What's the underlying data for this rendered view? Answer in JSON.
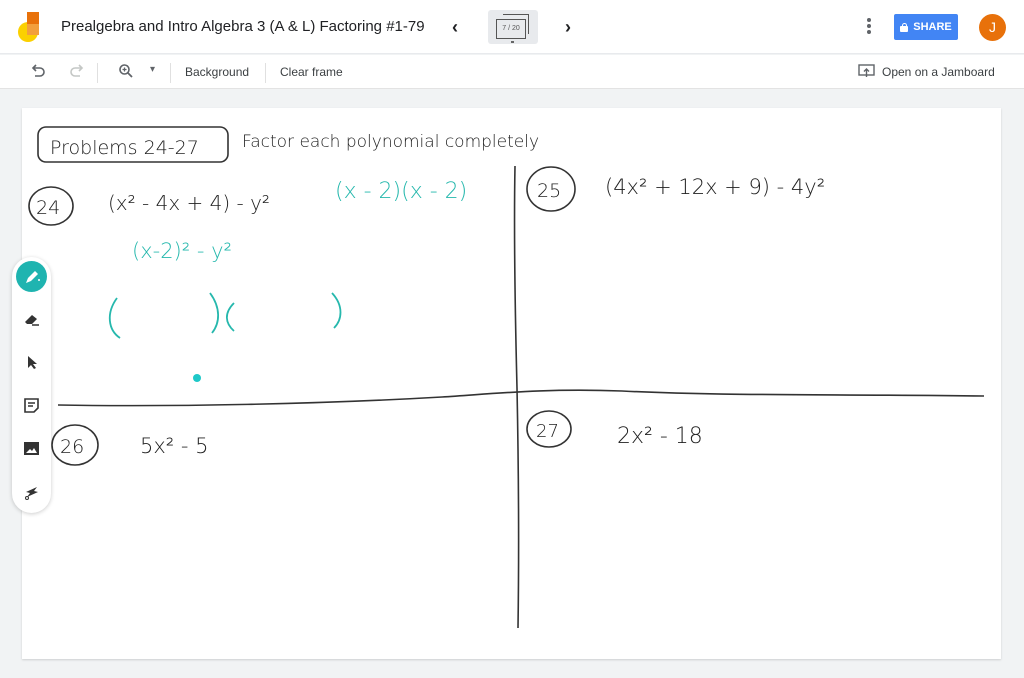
{
  "header": {
    "title": "Prealgebra and Intro Algebra 3 (A & L) Factoring #1-79",
    "prev_icon": "chevron-left-icon",
    "next_icon": "chevron-right-icon",
    "frame_indicator": "7 / 20",
    "more_icon": "more-vert-icon",
    "share_label": "SHARE",
    "avatar_initial": "J",
    "colors": {
      "share": "#4285f4",
      "avatar": "#e8710a"
    }
  },
  "toolbar": {
    "undo_icon": "undo-icon",
    "redo_icon": "redo-icon",
    "zoom_icon": "zoom-in-icon",
    "background_label": "Background",
    "clear_frame_label": "Clear frame",
    "open_jamboard_label": "Open on a Jamboard"
  },
  "tools": [
    {
      "name": "pen",
      "icon": "pen-icon",
      "active": true
    },
    {
      "name": "eraser",
      "icon": "eraser-icon",
      "active": false
    },
    {
      "name": "select",
      "icon": "select-arrow-icon",
      "active": false
    },
    {
      "name": "sticky-note",
      "icon": "sticky-note-icon",
      "active": false
    },
    {
      "name": "image",
      "icon": "image-icon",
      "active": false
    },
    {
      "name": "laser",
      "icon": "laser-icon",
      "active": false
    }
  ],
  "board": {
    "heading_box": "Problems 24-27",
    "instruction": "Factor each polynomial completely",
    "problems": [
      {
        "number": "24",
        "expression": "(x² - 4x + 4) - y²",
        "work": [
          "(x - 2)(x - 2)",
          "(x-2)² - y²",
          "(          )(          )"
        ]
      },
      {
        "number": "25",
        "expression": "(4x² + 12x + 9) - 4y²"
      },
      {
        "number": "26",
        "expression": "5x² - 5"
      },
      {
        "number": "27",
        "expression": "2x² - 18"
      }
    ],
    "ink_colors": {
      "black": "#222222",
      "teal": "#26b8ad"
    }
  }
}
